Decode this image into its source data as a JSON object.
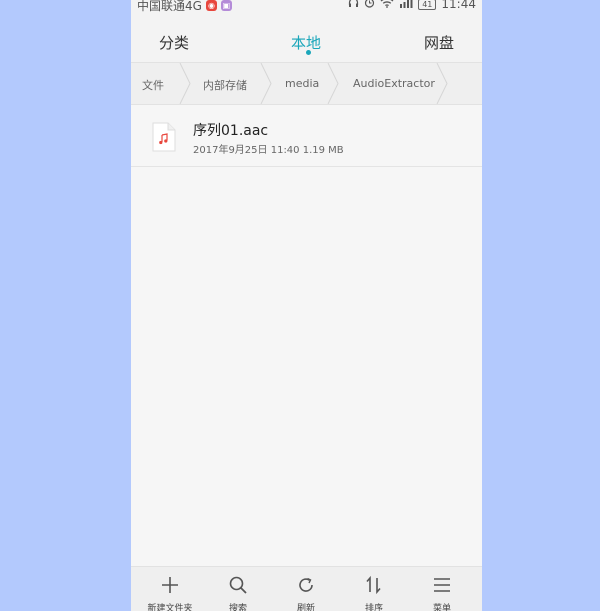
{
  "status_bar": {
    "carrier": "中国联通4G",
    "battery": "41",
    "time": "11:44",
    "icons": [
      "app-notification-red-icon",
      "app-notification-purple-icon",
      "headphones-icon",
      "alarm-icon",
      "wifi-icon",
      "signal-icon",
      "battery-icon"
    ]
  },
  "tabs": [
    {
      "label": "分类"
    },
    {
      "label": "本地",
      "active": true
    },
    {
      "label": "网盘"
    }
  ],
  "breadcrumb": [
    "文件",
    "内部存储",
    "media",
    "AudioExtractor"
  ],
  "files": [
    {
      "name": "序列01.aac",
      "meta": "2017年9月25日 11:40 1.19 MB",
      "icon": "audio-file-icon"
    }
  ],
  "bottom_bar": [
    {
      "label": "新建文件夹",
      "icon": "plus-icon"
    },
    {
      "label": "搜索",
      "icon": "search-icon"
    },
    {
      "label": "刷新",
      "icon": "refresh-icon"
    },
    {
      "label": "排序",
      "icon": "sort-icon"
    },
    {
      "label": "菜单",
      "icon": "menu-icon"
    }
  ],
  "colors": {
    "accent": "#1aa6ba",
    "outer_background": "#b3c9fd",
    "audio_icon": "#e8473d"
  }
}
